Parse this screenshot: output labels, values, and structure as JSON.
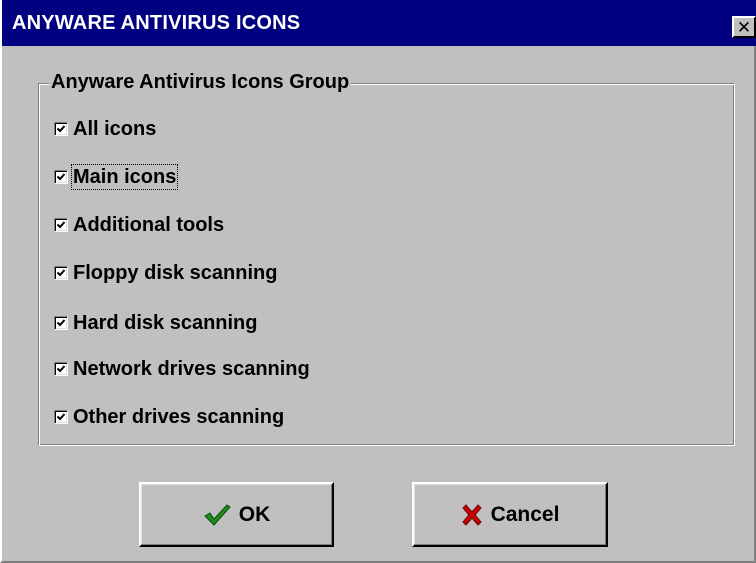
{
  "window": {
    "title": "ANYWARE ANTIVIRUS ICONS",
    "close_glyph": "✕"
  },
  "group": {
    "legend": "Anyware Antivirus Icons Group",
    "items": [
      {
        "label": "All icons",
        "checked": true
      },
      {
        "label": "Main icons",
        "checked": true,
        "focused": true
      },
      {
        "label": "Additional tools",
        "checked": true
      },
      {
        "label": "Floppy disk scanning",
        "checked": true
      },
      {
        "label": "Hard disk scanning",
        "checked": true
      },
      {
        "label": "Network drives scanning",
        "checked": true
      },
      {
        "label": "Other drives scanning",
        "checked": true
      }
    ]
  },
  "buttons": {
    "ok": {
      "label": "OK",
      "icon": "green-checkmark-icon"
    },
    "cancel": {
      "label": "Cancel",
      "icon": "red-x-icon"
    }
  },
  "colors": {
    "titlebar": "#000080",
    "face": "#c0c0c0",
    "ok_icon": "#1f8a1f",
    "cancel_icon": "#cc0000"
  }
}
